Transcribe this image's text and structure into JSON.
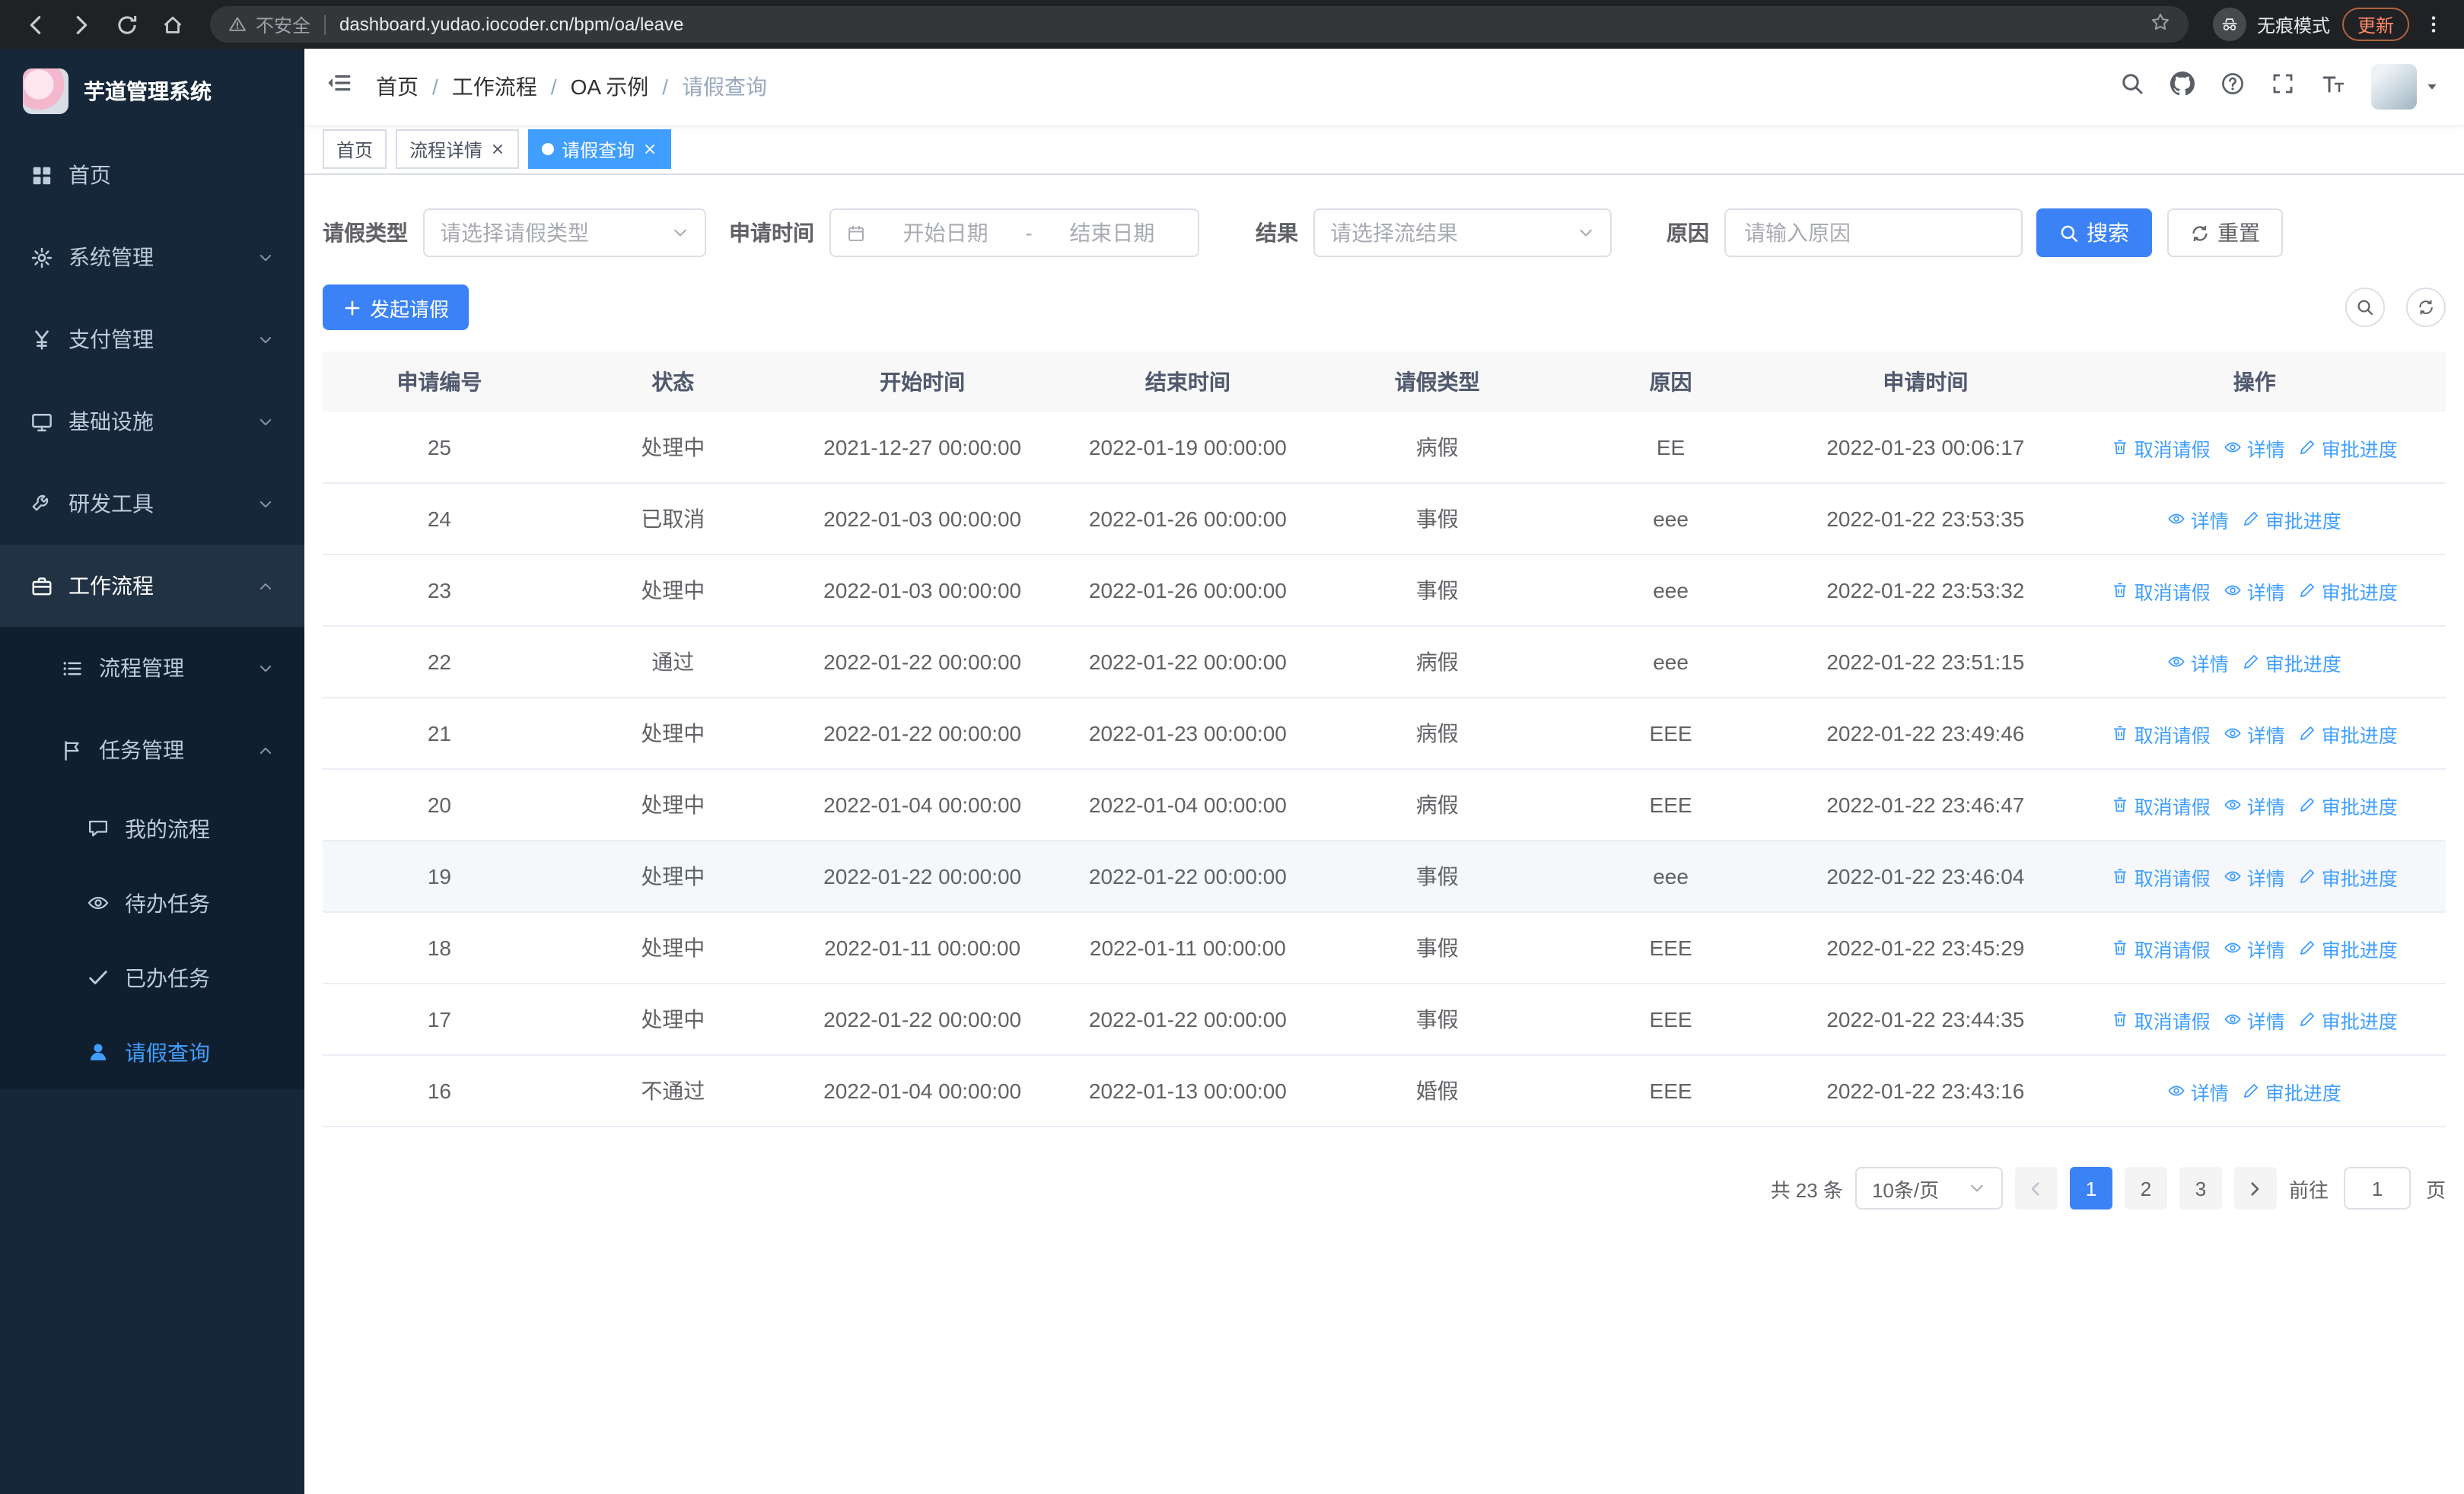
{
  "colors": {
    "primary": "#3b82f6",
    "link": "#409eff",
    "sidebar_bg": "#16273a",
    "sidebar_sub_bg": "#0f1f2f",
    "border": "#dcdfe6",
    "tborder": "#ebeef5"
  },
  "browser": {
    "security_label": "不安全",
    "url": "dashboard.yudao.iocoder.cn/bpm/oa/leave",
    "incognito_label": "无痕模式",
    "update_label": "更新"
  },
  "sidebar": {
    "logo_title": "芋道管理系统",
    "items": [
      {
        "label": "首页",
        "icon": "home-icon"
      },
      {
        "label": "系统管理",
        "icon": "gear-icon"
      },
      {
        "label": "支付管理",
        "icon": "yen-icon"
      },
      {
        "label": "基础设施",
        "icon": "platform-icon"
      },
      {
        "label": "研发工具",
        "icon": "tool-icon"
      },
      {
        "label": "工作流程",
        "icon": "briefcase-icon"
      }
    ],
    "sub_items": [
      {
        "label": "流程管理",
        "icon": "list-icon"
      },
      {
        "label": "任务管理",
        "icon": "flag-icon"
      }
    ],
    "leaf_items": [
      {
        "label": "我的流程",
        "icon": "chat-icon"
      },
      {
        "label": "待办任务",
        "icon": "eye-icon"
      },
      {
        "label": "已办任务",
        "icon": "check-icon"
      },
      {
        "label": "请假查询",
        "icon": "user-icon"
      }
    ]
  },
  "navbar": {
    "breadcrumb": [
      {
        "label": "首页"
      },
      {
        "label": "工作流程"
      },
      {
        "label": "OA 示例"
      },
      {
        "label": "请假查询"
      }
    ],
    "breadcrumb_separator": "/"
  },
  "tabs": [
    {
      "label": "首页"
    },
    {
      "label": "流程详情"
    },
    {
      "label": "请假查询"
    }
  ],
  "filters": {
    "leave_type_label": "请假类型",
    "leave_type_placeholder": "请选择请假类型",
    "apply_time_label": "申请时间",
    "start_placeholder": "开始日期",
    "range_separator": "-",
    "end_placeholder": "结束日期",
    "result_label": "结果",
    "result_placeholder": "请选择流结果",
    "reason_label": "原因",
    "reason_placeholder": "请输入原因",
    "search_label": "搜索",
    "reset_label": "重置"
  },
  "toolbar": {
    "create_label": "发起请假"
  },
  "table": {
    "headers": [
      "申请编号",
      "状态",
      "开始时间",
      "结束时间",
      "请假类型",
      "原因",
      "申请时间",
      "操作"
    ],
    "op_labels": {
      "cancel": "取消请假",
      "detail": "详情",
      "progress": "审批进度"
    },
    "op_icons": {
      "cancel": "trash",
      "detail": "eye",
      "progress": "edit"
    },
    "rows": [
      {
        "id": "25",
        "status": "处理中",
        "start": "2021-12-27 00:00:00",
        "end": "2022-01-19 00:00:00",
        "type": "病假",
        "reason": "EE",
        "applied": "2022-01-23 00:06:17",
        "ops": [
          "cancel",
          "detail",
          "progress"
        ]
      },
      {
        "id": "24",
        "status": "已取消",
        "start": "2022-01-03 00:00:00",
        "end": "2022-01-26 00:00:00",
        "type": "事假",
        "reason": "eee",
        "applied": "2022-01-22 23:53:35",
        "ops": [
          "detail",
          "progress"
        ]
      },
      {
        "id": "23",
        "status": "处理中",
        "start": "2022-01-03 00:00:00",
        "end": "2022-01-26 00:00:00",
        "type": "事假",
        "reason": "eee",
        "applied": "2022-01-22 23:53:32",
        "ops": [
          "cancel",
          "detail",
          "progress"
        ]
      },
      {
        "id": "22",
        "status": "通过",
        "start": "2022-01-22 00:00:00",
        "end": "2022-01-22 00:00:00",
        "type": "病假",
        "reason": "eee",
        "applied": "2022-01-22 23:51:15",
        "ops": [
          "detail",
          "progress"
        ]
      },
      {
        "id": "21",
        "status": "处理中",
        "start": "2022-01-22 00:00:00",
        "end": "2022-01-23 00:00:00",
        "type": "病假",
        "reason": "EEE",
        "applied": "2022-01-22 23:49:46",
        "ops": [
          "cancel",
          "detail",
          "progress"
        ]
      },
      {
        "id": "20",
        "status": "处理中",
        "start": "2022-01-04 00:00:00",
        "end": "2022-01-04 00:00:00",
        "type": "病假",
        "reason": "EEE",
        "applied": "2022-01-22 23:46:47",
        "ops": [
          "cancel",
          "detail",
          "progress"
        ]
      },
      {
        "id": "19",
        "status": "处理中",
        "start": "2022-01-22 00:00:00",
        "end": "2022-01-22 00:00:00",
        "type": "事假",
        "reason": "eee",
        "applied": "2022-01-22 23:46:04",
        "ops": [
          "cancel",
          "detail",
          "progress"
        ],
        "highlight": true
      },
      {
        "id": "18",
        "status": "处理中",
        "start": "2022-01-11 00:00:00",
        "end": "2022-01-11 00:00:00",
        "type": "事假",
        "reason": "EEE",
        "applied": "2022-01-22 23:45:29",
        "ops": [
          "cancel",
          "detail",
          "progress"
        ]
      },
      {
        "id": "17",
        "status": "处理中",
        "start": "2022-01-22 00:00:00",
        "end": "2022-01-22 00:00:00",
        "type": "事假",
        "reason": "EEE",
        "applied": "2022-01-22 23:44:35",
        "ops": [
          "cancel",
          "detail",
          "progress"
        ]
      },
      {
        "id": "16",
        "status": "不通过",
        "start": "2022-01-04 00:00:00",
        "end": "2022-01-13 00:00:00",
        "type": "婚假",
        "reason": "EEE",
        "applied": "2022-01-22 23:43:16",
        "ops": [
          "detail",
          "progress"
        ]
      }
    ]
  },
  "pagination": {
    "total_label": "共 23 条",
    "page_size": "10条/页",
    "pages": [
      "1",
      "2",
      "3"
    ],
    "active_page": "1",
    "goto_label": "前往",
    "goto_value": "1",
    "page_unit": "页"
  }
}
